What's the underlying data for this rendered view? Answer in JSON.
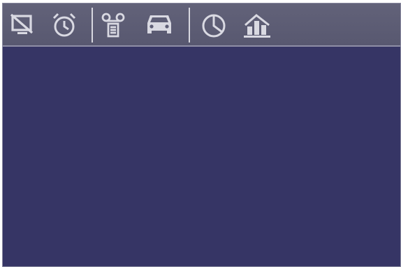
{
  "toolbar": {
    "icon_color": "#d9d9e2",
    "buttons": [
      {
        "icon": "monitor-off-icon"
      },
      {
        "icon": "alarm-clock-icon"
      },
      {
        "icon": "voicemail-icon"
      },
      {
        "icon": "car-icon"
      },
      {
        "icon": "pie-chart-icon"
      },
      {
        "icon": "bar-chart-icon"
      }
    ]
  },
  "colors": {
    "toolbar_background": "#5e5e76",
    "content_background": "#363565",
    "separator": "#d8d8e0"
  }
}
